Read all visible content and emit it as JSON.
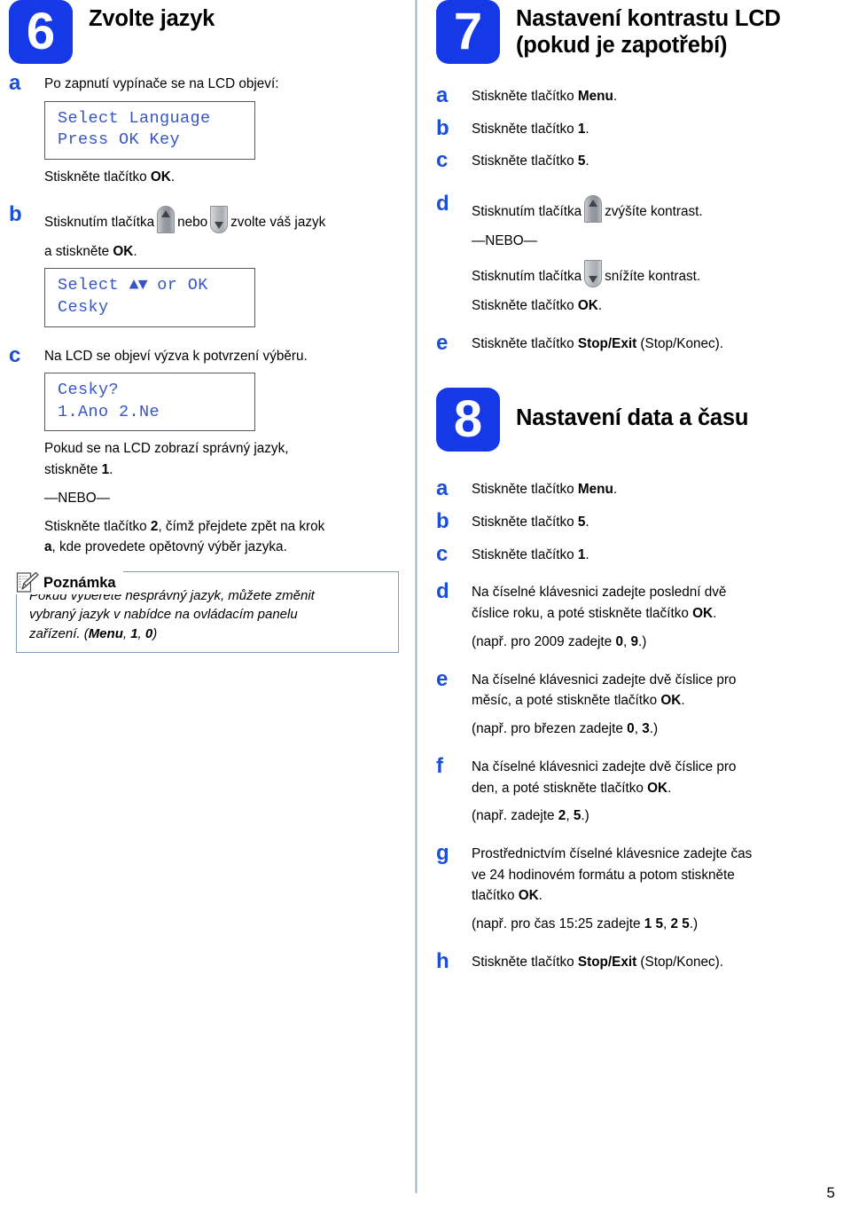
{
  "page": {
    "number": "5",
    "language": "cs"
  },
  "left_column": {
    "step": {
      "number": "6",
      "title_line1": "Zvolte jazyk",
      "title_line2": ""
    },
    "items": [
      {
        "letter": "a",
        "intro": "Po zapnutí vypínače se na LCD objeví:",
        "lcd": {
          "line1": "Select Language",
          "line2": "Press OK Key"
        },
        "after_prefix": "Stiskněte tlačítko ",
        "after_bold": "OK",
        "after_suffix": "."
      },
      {
        "letter": "b",
        "text_part1": "Stisknutím tlačítka",
        "text_part2": "nebo",
        "text_part3": "zvolte váš jazyk",
        "text_part4_prefix": "a stiskněte ",
        "text_part4_bold": "OK",
        "text_part4_suffix": ".",
        "lcd": {
          "line1_pre": "Select ",
          "line1_tri": "▲▼",
          "line1_post": " or OK",
          "line2": "Cesky"
        }
      },
      {
        "letter": "c",
        "intro": "Na LCD se objeví výzva k potvrzení výběru.",
        "lcd": {
          "line1": "Cesky?",
          "line2": "1.Ano 2.Ne"
        },
        "p1_prefix": "Pokud se na LCD zobrazí správný jazyk,",
        "p1_line2_prefix": "stiskněte ",
        "p1_line2_bold": "1",
        "p1_line2_suffix": ".",
        "or_label": "—NEBO—",
        "p2_prefix": "Stiskněte tlačítko ",
        "p2_bold1": "2",
        "p2_mid": ", čímž přejdete zpět na krok",
        "p2_bold2": "a",
        "p2_suffix": ", kde provedete opětovný výběr jazyka."
      }
    ],
    "note": {
      "title": "Poznámka",
      "line1": "Pokud vyberete nesprávný jazyk, můžete změnit",
      "line2": "vybraný jazyk v nabídce na ovládacím panelu",
      "line3_prefix": "zařízení. (",
      "line3_b1": "Menu",
      "line3_m1": ", ",
      "line3_b2": "1",
      "line3_m2": ", ",
      "line3_b3": "0",
      "line3_suffix": ")"
    }
  },
  "right_column": {
    "step7": {
      "number": "7",
      "title_line1": "Nastavení kontrastu LCD",
      "title_line2": "(pokud je zapotřebí)",
      "items": [
        {
          "letter": "a",
          "prefix": "Stiskněte tlačítko ",
          "bold": "Menu",
          "suffix": "."
        },
        {
          "letter": "b",
          "prefix": "Stiskněte tlačítko ",
          "bold": "1",
          "suffix": "."
        },
        {
          "letter": "c",
          "prefix": "Stiskněte tlačítko ",
          "bold": "5",
          "suffix": "."
        }
      ],
      "item_d": {
        "letter": "d",
        "up_prefix": "Stisknutím tlačítka",
        "up_suffix": "zvýšíte kontrast.",
        "or_label": "—NEBO—",
        "down_prefix": "Stisknutím tlačítka",
        "down_suffix": "snížíte kontrast.",
        "ok_prefix": "Stiskněte tlačítko ",
        "ok_bold": "OK",
        "ok_suffix": "."
      },
      "item_e": {
        "letter": "e",
        "prefix": "Stiskněte tlačítko ",
        "bold": "Stop/Exit",
        "suffix": " (Stop/Konec)."
      }
    },
    "step8": {
      "number": "8",
      "title_line1": "Nastavení data a času",
      "title_line2": "",
      "items": [
        {
          "letter": "a",
          "prefix": "Stiskněte tlačítko ",
          "bold": "Menu",
          "suffix": "."
        },
        {
          "letter": "b",
          "prefix": "Stiskněte tlačítko ",
          "bold": "5",
          "suffix": "."
        },
        {
          "letter": "c",
          "prefix": "Stiskněte tlačítko ",
          "bold": "1",
          "suffix": "."
        }
      ],
      "item_d": {
        "letter": "d",
        "line1": "Na číselné klávesnici zadejte poslední dvě",
        "line2_prefix": "číslice roku, a poté stiskněte tlačítko ",
        "line2_bold": "OK",
        "line2_suffix": ".",
        "eg_prefix": "(např. pro 2009 zadejte ",
        "eg_b1": "0",
        "eg_mid": ", ",
        "eg_b2": "9",
        "eg_suffix": ".)"
      },
      "item_e": {
        "letter": "e",
        "line1": "Na číselné klávesnici zadejte dvě číslice pro",
        "line2_prefix": "měsíc, a poté stiskněte tlačítko ",
        "line2_bold": "OK",
        "line2_suffix": ".",
        "eg_prefix": "(např. pro březen zadejte ",
        "eg_b1": "0",
        "eg_mid": ", ",
        "eg_b2": "3",
        "eg_suffix": ".)"
      },
      "item_f": {
        "letter": "f",
        "line1": "Na číselné klávesnici zadejte dvě číslice pro",
        "line2_prefix": "den, a poté stiskněte tlačítko ",
        "line2_bold": "OK",
        "line2_suffix": ".",
        "eg_prefix": "(např. zadejte ",
        "eg_b1": "2",
        "eg_mid": ", ",
        "eg_b2": "5",
        "eg_suffix": ".)"
      },
      "item_g": {
        "letter": "g",
        "line1": "Prostřednictvím číselné klávesnice zadejte čas",
        "line2": "ve 24 hodinovém formátu a potom stiskněte",
        "line3_prefix": "tlačítko ",
        "line3_bold": "OK",
        "line3_suffix": ".",
        "eg_prefix": "(např. pro čas 15:25 zadejte ",
        "eg_b1": "1 5",
        "eg_mid": ", ",
        "eg_b2": "2 5",
        "eg_suffix": ".)"
      },
      "item_h": {
        "letter": "h",
        "prefix": "Stiskněte tlačítko ",
        "bold": "Stop/Exit",
        "suffix": " (Stop/Konec)."
      }
    }
  },
  "colors": {
    "badge_blue": "#1639e8",
    "letter_blue": "#1a4fd6",
    "lcd_text_blue": "#3756c4",
    "note_border": "#7d9dbd",
    "divider": "#8ca6c0"
  }
}
